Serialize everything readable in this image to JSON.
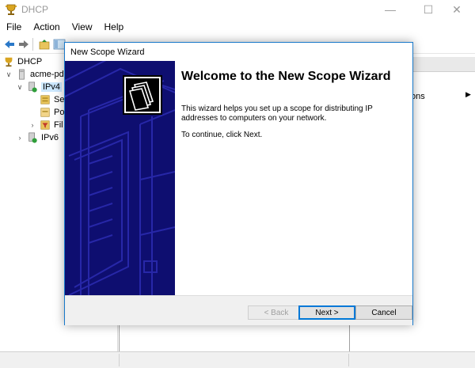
{
  "window": {
    "title": "DHCP",
    "minimize_glyph": "—",
    "maximize_glyph": "☐",
    "close_glyph": "✕"
  },
  "menu": {
    "items": [
      "File",
      "Action",
      "View",
      "Help"
    ]
  },
  "tree": {
    "root": "DHCP",
    "server": "acme-pdc",
    "ipv4": "IPv4",
    "child1": "Se",
    "child2": "Po",
    "child3": "Fil",
    "ipv6": "IPv6"
  },
  "actions": {
    "item_fragment": "ons"
  },
  "wizard": {
    "title": "New Scope Wizard",
    "heading": "Welcome to the New Scope Wizard",
    "description": "This wizard helps you set up a scope for distributing IP addresses to computers on your network.",
    "continue_text": "To continue, click Next.",
    "back_label": "< Back",
    "next_label": "Next >",
    "cancel_label": "Cancel"
  },
  "colors": {
    "banner": "#0e0e70",
    "banner_lines": "#2727a8",
    "accent": "#0078d7"
  }
}
